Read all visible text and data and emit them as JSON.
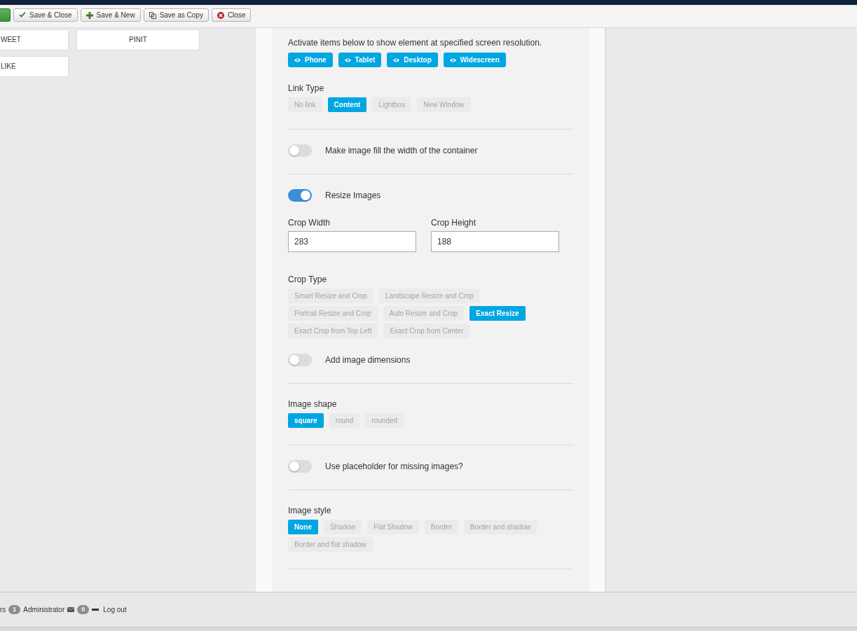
{
  "toolbar": [
    {
      "kind": "apply"
    },
    {
      "kind": "save_close",
      "label": "Save & Close"
    },
    {
      "kind": "save_new",
      "label": "Save & New"
    },
    {
      "kind": "save_copy",
      "label": "Save as Copy"
    },
    {
      "kind": "close",
      "label": "Close"
    }
  ],
  "tiles": [
    {
      "label": "WEET"
    },
    {
      "label": "PINIT"
    },
    {
      "label": "LIKE"
    }
  ],
  "panel": {
    "groups": [
      {
        "fields": [
          {
            "kind": "devices",
            "text": "Activate items below to show element at specified screen resolution.",
            "buttons": [
              {
                "label": "Phone",
                "active": true
              },
              {
                "label": "Tablet",
                "active": true
              },
              {
                "label": "Desktop",
                "active": true
              },
              {
                "label": "Widescreen",
                "active": true
              }
            ]
          },
          {
            "kind": "choice",
            "label": "Link Type",
            "options": [
              {
                "label": "No link",
                "selected": false
              },
              {
                "label": "Content",
                "selected": true
              },
              {
                "label": "Lightbox",
                "selected": false
              },
              {
                "label": "New Window",
                "selected": false
              }
            ]
          }
        ]
      },
      {
        "fields": [
          {
            "kind": "toggle",
            "label": "Make image fill the width of the container",
            "on": false
          }
        ]
      },
      {
        "fields": [
          {
            "kind": "toggle",
            "label": "Resize Images",
            "on": true
          },
          {
            "kind": "inputs",
            "inputs": [
              {
                "label": "Crop Width",
                "value": "283"
              },
              {
                "label": "Crop Height",
                "value": "188"
              }
            ]
          },
          {
            "kind": "choice",
            "label": "Crop Type",
            "options": [
              {
                "label": "Smart Resize and Crop",
                "selected": false
              },
              {
                "label": "Landscape Resize and Crop",
                "selected": false
              },
              {
                "label": "Portrait Resize and Crop",
                "selected": false
              },
              {
                "label": "Auto Resize and Crop",
                "selected": false
              },
              {
                "label": "Exact Resize",
                "selected": true
              },
              {
                "label": "Exact Crop from Top Left",
                "selected": false
              },
              {
                "label": "Exact Crop from Center",
                "selected": false
              }
            ]
          },
          {
            "kind": "toggle",
            "label": "Add image dimensions",
            "on": false
          }
        ]
      },
      {
        "fields": [
          {
            "kind": "choice",
            "label": "Image shape",
            "options": [
              {
                "label": "square",
                "selected": true
              },
              {
                "label": "round",
                "selected": false
              },
              {
                "label": "rounded",
                "selected": false
              }
            ]
          }
        ]
      },
      {
        "fields": [
          {
            "kind": "toggle",
            "label": "Use placeholder for missing images?",
            "on": false
          }
        ]
      },
      {
        "fields": [
          {
            "kind": "choice",
            "label": "Image style",
            "options": [
              {
                "label": "None",
                "selected": true
              },
              {
                "label": "Shadow",
                "selected": false
              },
              {
                "label": "Flat Shadow",
                "selected": false
              },
              {
                "label": "Border",
                "selected": false
              },
              {
                "label": "Border and shadow",
                "selected": false
              },
              {
                "label": "Border and flat shadow",
                "selected": false
              }
            ]
          }
        ]
      }
    ]
  },
  "status_bar": {
    "items": [
      {
        "kind": "text",
        "text": "rs"
      },
      {
        "kind": "badge",
        "text": "1"
      },
      {
        "kind": "text",
        "text": "Administrator"
      },
      {
        "kind": "mail_icon"
      },
      {
        "kind": "badge",
        "text": "0"
      },
      {
        "kind": "minus_icon"
      },
      {
        "kind": "link",
        "text": "Log out"
      }
    ]
  }
}
